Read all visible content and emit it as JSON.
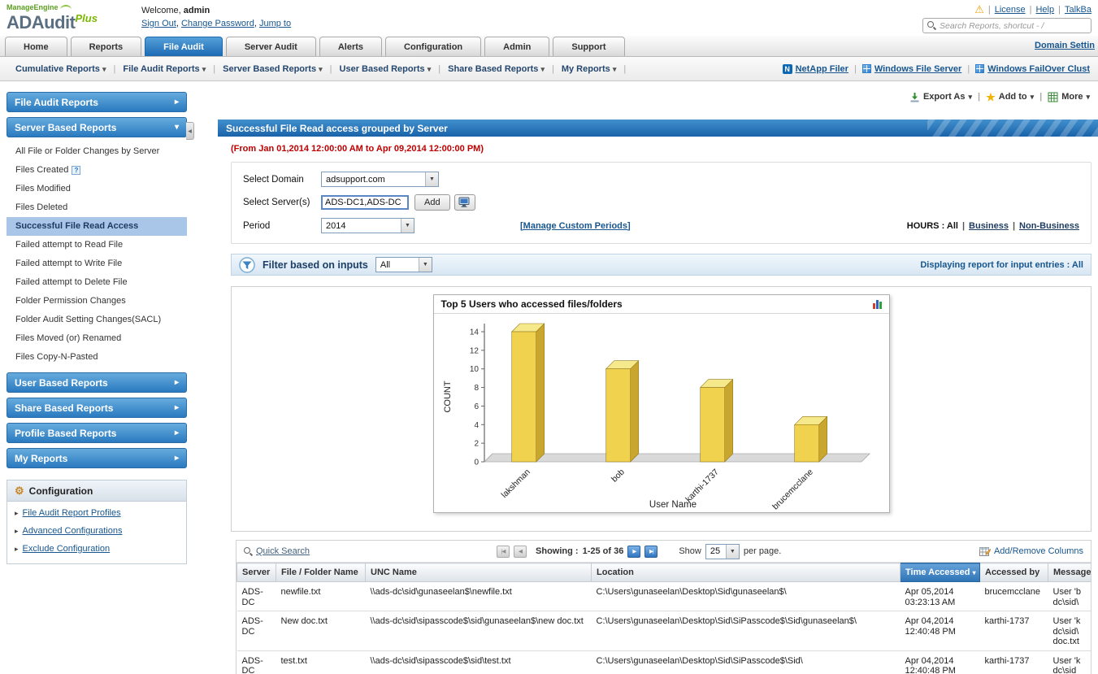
{
  "icons": {
    "warning": "⚠",
    "caret_down": "▾",
    "select_caret": "▼",
    "arrow_right": "▸",
    "arrow_down": "▾",
    "star": "★",
    "gear": "⚙",
    "first": "|◀",
    "prev": "◀",
    "next": "▶",
    "last": "▶|",
    "sort_desc": "▾",
    "help": "?",
    "collapse": "◀"
  },
  "header": {
    "brand": "ManageEngine",
    "product": "ADAudit",
    "product_suffix": "Plus",
    "welcome_prefix": "Welcome,",
    "welcome_user": "admin",
    "account_links": [
      "Sign Out",
      "Change Password",
      "Jump to"
    ],
    "top_links": [
      "License",
      "Help",
      "TalkBa"
    ],
    "search_placeholder": "Search Reports, shortcut - /"
  },
  "tabs": {
    "items": [
      "Home",
      "Reports",
      "File Audit",
      "Server Audit",
      "Alerts",
      "Configuration",
      "Admin",
      "Support"
    ],
    "active": "File Audit",
    "domain_settings_link": "Domain Settin"
  },
  "menubar": {
    "items": [
      "Cumulative Reports",
      "File Audit Reports",
      "Server Based Reports",
      "User Based Reports",
      "Share Based Reports",
      "My Reports"
    ],
    "links": [
      {
        "label": "NetApp Filer",
        "icon": "netapp"
      },
      {
        "label": "Windows File Server",
        "icon": "windows"
      },
      {
        "label": "Windows FailOver Clust",
        "icon": "windows"
      }
    ]
  },
  "sidebar": {
    "groups": [
      {
        "label": "File Audit Reports",
        "expanded": false
      },
      {
        "label": "Server Based Reports",
        "expanded": true,
        "items": [
          {
            "label": "All File or Folder Changes by Server"
          },
          {
            "label": "Files Created",
            "help": true
          },
          {
            "label": "Files Modified"
          },
          {
            "label": "Files Deleted"
          },
          {
            "label": "Successful File Read Access",
            "selected": true
          },
          {
            "label": "Failed attempt to Read File"
          },
          {
            "label": "Failed attempt to Write File"
          },
          {
            "label": "Failed attempt to Delete File"
          },
          {
            "label": "Folder Permission Changes"
          },
          {
            "label": "Folder Audit Setting Changes(SACL)"
          },
          {
            "label": "Files Moved (or) Renamed"
          },
          {
            "label": "Files Copy-N-Pasted"
          }
        ]
      },
      {
        "label": "User Based Reports",
        "expanded": false
      },
      {
        "label": "Share Based Reports",
        "expanded": false
      },
      {
        "label": "Profile Based Reports",
        "expanded": false
      },
      {
        "label": "My Reports",
        "expanded": false
      }
    ],
    "configuration": {
      "title": "Configuration",
      "items": [
        "File Audit Report Profiles",
        "Advanced Configurations",
        "Exclude Configuration"
      ]
    }
  },
  "main": {
    "actions": [
      {
        "label": "Export As"
      },
      {
        "label": "Add to"
      },
      {
        "label": "More"
      }
    ],
    "report_title": "Successful File Read access grouped by Server",
    "date_range": "(From Jan 01,2014 12:00:00 AM to Apr 09,2014 12:00:00 PM)",
    "form": {
      "domain_label": "Select Domain",
      "domain_value": "adsupport.com",
      "servers_label": "Select Server(s)",
      "servers_value": "ADS-DC1,ADS-DC",
      "add_button": "Add",
      "period_label": "Period",
      "period_value": "2014",
      "manage_periods_link": "[Manage Custom Periods]",
      "hours_prefix": "HOURS : All",
      "hours_links": [
        "Business",
        "Non-Business"
      ]
    },
    "filter": {
      "label": "Filter based on inputs",
      "value": "All",
      "right_text": "Displaying report for input entries : All"
    }
  },
  "chart_data": {
    "type": "bar",
    "style": "3d-bar",
    "title": "Top 5 Users who accessed files/folders",
    "categories": [
      "lakshman",
      "bob",
      "karthi-1737",
      "brucemcclane"
    ],
    "values": [
      14,
      10,
      8,
      4
    ],
    "xlabel": "User Name",
    "ylabel": "COUNT",
    "ylim": [
      0,
      14
    ],
    "yticks": [
      0,
      2,
      4,
      6,
      8,
      10,
      12,
      14
    ],
    "bar_color": "#F0D24E",
    "grid": false,
    "legend": false
  },
  "table": {
    "quick_search": "Quick Search",
    "paging": {
      "showing_label": "Showing :",
      "range": "1-25 of 36",
      "show_label": "Show",
      "page_size": "25",
      "per_page_label": "per page."
    },
    "add_remove_columns": "Add/Remove Columns",
    "columns": [
      "Server",
      "File / Folder Name",
      "UNC Name",
      "Location",
      "Time Accessed",
      "Accessed by",
      "Message"
    ],
    "rows": [
      {
        "server": "ADS-DC",
        "file_name": "newfile.txt",
        "unc": "\\\\ads-dc\\sid\\gunaseelan$\\newfile.txt",
        "location": "C:\\Users\\gunaseelan\\Desktop\\Sid\\gunaseelan$\\",
        "time": "Apr 05,2014 03:23:13 AM",
        "accessed_by": "brucemcclane",
        "message": "User 'b\ndc\\sid\\"
      },
      {
        "server": "ADS-DC",
        "file_name": "New doc.txt",
        "unc": "\\\\ads-dc\\sid\\sipasscode$\\sid\\gunaseelan$\\new doc.txt",
        "location": "C:\\Users\\gunaseelan\\Desktop\\Sid\\SiPasscode$\\Sid\\gunaseelan$\\",
        "time": "Apr 04,2014 12:40:48 PM",
        "accessed_by": "karthi-1737",
        "message": "User 'k\ndc\\sid\\\ndoc.txt"
      },
      {
        "server": "ADS-DC",
        "file_name": "test.txt",
        "unc": "\\\\ads-dc\\sid\\sipasscode$\\sid\\test.txt",
        "location": "C:\\Users\\gunaseelan\\Desktop\\Sid\\SiPasscode$\\Sid\\",
        "time": "Apr 04,2014 12:40:48 PM",
        "accessed_by": "karthi-1737",
        "message": "User 'k\ndc\\sid"
      }
    ]
  }
}
